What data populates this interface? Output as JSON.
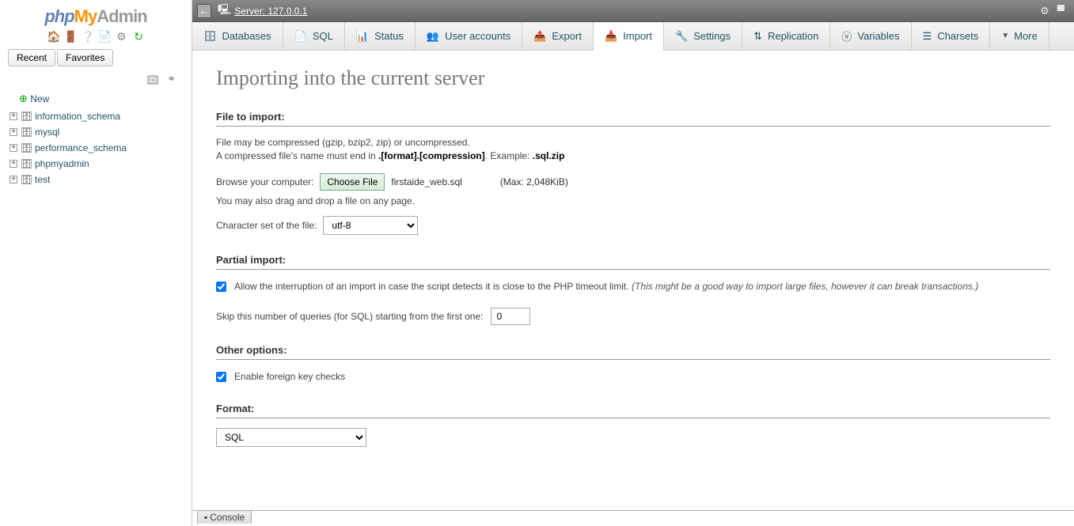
{
  "logo": {
    "php": "php",
    "my": "My",
    "admin": "Admin"
  },
  "sidebar": {
    "recent_label": "Recent",
    "favorites_label": "Favorites",
    "new_label": "New",
    "databases": [
      "information_schema",
      "mysql",
      "performance_schema",
      "phpmyadmin",
      "test"
    ]
  },
  "server_bar": {
    "label": "Server: 127.0.0.1"
  },
  "tabs": [
    {
      "label": "Databases",
      "icon": "db"
    },
    {
      "label": "SQL",
      "icon": "sql"
    },
    {
      "label": "Status",
      "icon": "status"
    },
    {
      "label": "User accounts",
      "icon": "users"
    },
    {
      "label": "Export",
      "icon": "export"
    },
    {
      "label": "Import",
      "icon": "import",
      "active": true
    },
    {
      "label": "Settings",
      "icon": "settings"
    },
    {
      "label": "Replication",
      "icon": "replication"
    },
    {
      "label": "Variables",
      "icon": "variables"
    },
    {
      "label": "Charsets",
      "icon": "charsets"
    },
    {
      "label": "More",
      "icon": "more"
    }
  ],
  "page": {
    "heading": "Importing into the current server",
    "file_section": "File to import:",
    "file_help1": "File may be compressed (gzip, bzip2, zip) or uncompressed.",
    "file_help2a": "A compressed file's name must end in ",
    "file_help2b": ".[format].[compression]",
    "file_help2c": ". Example: ",
    "file_help2d": ".sql.zip",
    "browse_label": "Browse your computer:",
    "choose_file": "Choose File",
    "chosen_file": "firstaide_web.sql",
    "max_size": "(Max: 2,048KiB)",
    "drag_note": "You may also drag and drop a file on any page.",
    "charset_label": "Character set of the file:",
    "charset_value": "utf-8",
    "partial_section": "Partial import:",
    "partial_opt": "Allow the interruption of an import in case the script detects it is close to the PHP timeout limit. ",
    "partial_note": "(This might be a good way to import large files, however it can break transactions.)",
    "skip_label": "Skip this number of queries (for SQL) starting from the first one:",
    "skip_value": "0",
    "other_section": "Other options:",
    "fk_label": "Enable foreign key checks",
    "format_section": "Format:",
    "format_value": "SQL"
  },
  "console": {
    "label": "Console"
  }
}
